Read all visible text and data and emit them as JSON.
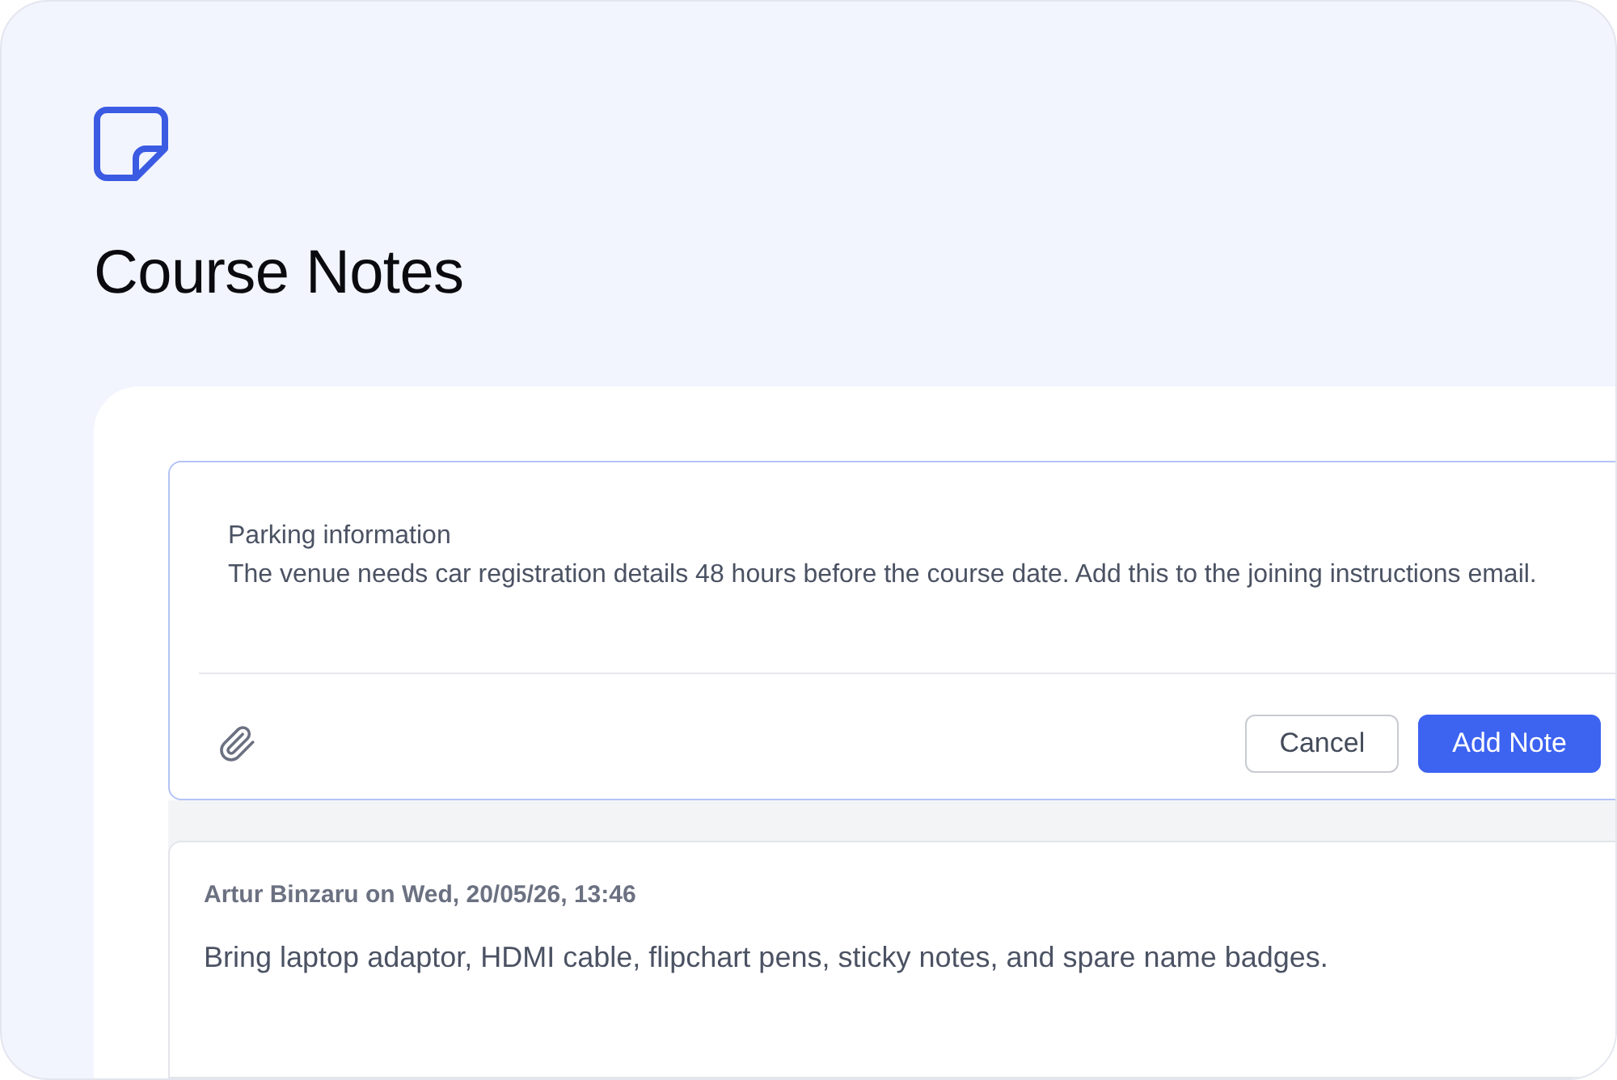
{
  "page": {
    "title": "Course Notes"
  },
  "editor": {
    "value": "Parking information\nThe venue needs car registration details 48 hours before the course date. Add this to the joining instructions email.",
    "buttons": [
      {
        "kind": "secondary",
        "label": "Cancel"
      },
      {
        "kind": "primary",
        "label": "Add Note"
      }
    ]
  },
  "notes": [
    {
      "meta": "Artur Binzaru on Wed, 20/05/26, 13:46",
      "body": "Bring laptop adaptor, HDMI cable, flipchart pens, sticky notes, and spare name badges."
    }
  ]
}
